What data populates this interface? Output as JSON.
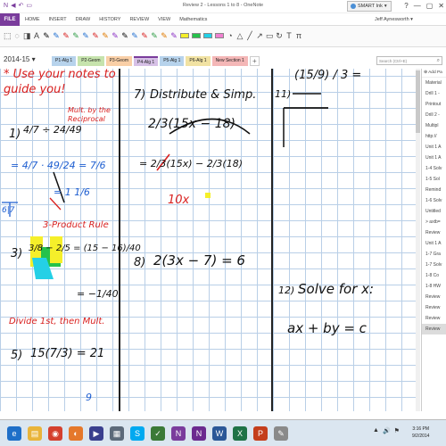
{
  "window": {
    "title": "Review 2 - Lessons 1 to 8 - OneNote",
    "smart_ink_label": "SMART Ink",
    "window_controls": [
      "?",
      "—",
      "▢",
      "✕"
    ]
  },
  "ribbon": {
    "file": "FILE",
    "tabs": [
      "HOME",
      "INSERT",
      "DRAW",
      "HISTORY",
      "REVIEW",
      "VIEW",
      "Mathematics"
    ],
    "user": "Jeff Aynesworth ▾"
  },
  "notebook": {
    "name": "2014-15 ▾",
    "sections": [
      {
        "label": "P1-Alg 1",
        "color": "#b7d3ec"
      },
      {
        "label": "P2-Geom",
        "color": "#c6e3ad"
      },
      {
        "label": "P3-Geom",
        "color": "#f9cfa7"
      },
      {
        "label": "P4-Alg 1",
        "color": "#d6c0e6"
      },
      {
        "label": "P5-Alg 1",
        "color": "#b7d3ec"
      },
      {
        "label": "P6-Alg 1",
        "color": "#f1e2a3"
      },
      {
        "label": "New Section 1",
        "color": "#f4b7b7"
      }
    ],
    "add_tab": "+",
    "search_placeholder": "Search (Ctrl+E)"
  },
  "pagelist": {
    "add_page": "⊕ Add Pa",
    "pages": [
      "Material",
      "Drill 1 -",
      "Printout",
      "Drill 2 -",
      "Multipl",
      "http://",
      "Unit 1 A",
      "Unit 1 A",
      "1-4 Solv",
      "1-5 Sol",
      "Remind",
      "1-6 Solv",
      "Untitled",
      "> axtb=",
      "Review",
      "Unit 1 A",
      "1-7 Gra",
      "1-7 Solv",
      "1-8 Co",
      "1-8 HW",
      "Review",
      "Review",
      "Review",
      "Review"
    ],
    "active_index": 23
  },
  "ink": {
    "header": "* Use your notes to guide you!",
    "p1_note": "Mult. by the Reciprocal",
    "p1_num": "1)",
    "p1_expr": "4/7 ÷ 24/49",
    "p1_step": "= 4/7 · 49/24 = 7/6",
    "p1_ans": "= 1 1/6",
    "p1_box": "6|7",
    "p3_num": "3)",
    "p3_title": "3-Product Rule",
    "p3_expr": "3/8 − 2/5 = (15 − 16)/40",
    "p3_ans": "= −1/40",
    "p5_title": "Divide 1st, then Mult.",
    "p5_num": "5)",
    "p5_expr": "15(7/3) = 21",
    "p5_extra": "9",
    "p7_num": "7)",
    "p7_title": "Distribute & Simp.",
    "p7_expr": "2/3(15x − 18)",
    "p7_step": "= 2/3(15x) − 2/3(18)",
    "p7_partial": "10x",
    "p8_num": "8)",
    "p8_expr": "2(3x − 7) = 6",
    "p11_num": "11)",
    "p11_expr": "(15/9) / 3 =",
    "p12_num": "12)",
    "p12_title": "Solve for x:",
    "p12_expr": "ax + by = c"
  },
  "taskbar": {
    "apps": [
      "IE",
      "Folder",
      "Chrome",
      "Firefox",
      "Media",
      "Calc",
      "Skype",
      "SMART",
      "OneNote",
      "N",
      "Word",
      "Excel",
      "PPT",
      "Paint"
    ],
    "tray": [
      "▲",
      "🔊",
      "⚑"
    ],
    "time": "3:16 PM",
    "date": "9/2/2014"
  },
  "colors": {
    "accent": "#7a3c9c",
    "ink_black": "#111111",
    "ink_red": "#d9201f",
    "ink_blue": "#1f5fd1",
    "highlight_yellow": "#f5ef2a",
    "highlight_green": "#26c24b",
    "highlight_cyan": "#24d0e6"
  }
}
